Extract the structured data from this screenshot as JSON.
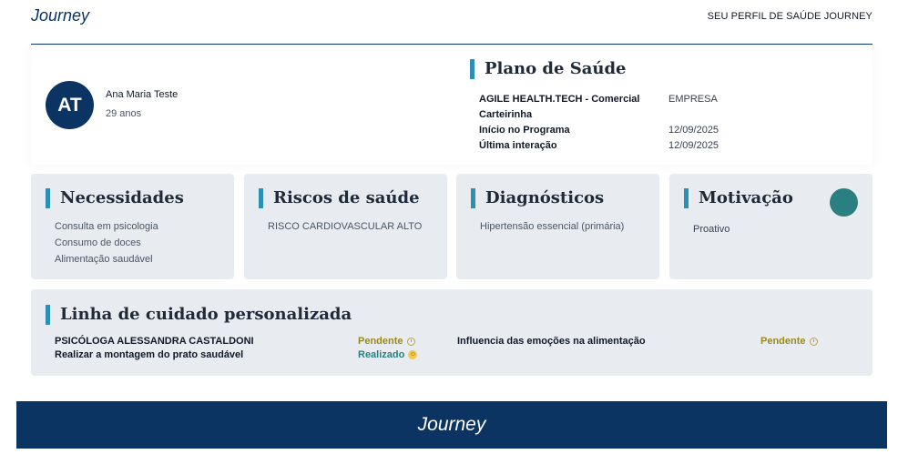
{
  "header": {
    "brand": "Journey",
    "subtitle": "SEU PERFIL DE SAÚDE JOURNEY"
  },
  "profile": {
    "initials": "AT",
    "name": "Ana Maria Teste",
    "age": "29 anos"
  },
  "plan": {
    "title": "Plano de Saúde",
    "rows": [
      {
        "label": "AGILE HEALTH.TECH - Comercial",
        "value": "EMPRESA"
      },
      {
        "label": "Carteirinha",
        "value": ""
      },
      {
        "label": "Início no Programa",
        "value": "12/09/2025"
      },
      {
        "label": "Última interação",
        "value": "12/09/2025"
      }
    ]
  },
  "needs": {
    "title": "Necessidades",
    "items": [
      "Consulta em psicologia",
      "Consumo de doces",
      "Alimentação saudável"
    ]
  },
  "risks": {
    "title": "Riscos de saúde",
    "items": [
      "RISCO CARDIOVASCULAR ALTO"
    ]
  },
  "diagnostics": {
    "title": "Diagnósticos",
    "items": [
      "Hipertensão essencial (primária)"
    ]
  },
  "motivation": {
    "title": "Motivação",
    "value": "Proativo",
    "indicator_color": "#2a8080"
  },
  "care_line": {
    "title": "Linha de cuidado personalizada",
    "items": [
      {
        "label": "PSICÓLOGA ALESSANDRA CASTALDONI",
        "status": "Pendente",
        "icon": "clock-icon"
      },
      {
        "label": "Realizar a montagem do prato saudável",
        "status": "Realizado",
        "icon": "smile-icon"
      },
      {
        "label": "Influencia das emoções na alimentação",
        "status": "Pendente",
        "icon": "clock-icon"
      }
    ]
  },
  "footer": {
    "brand": "Journey"
  },
  "colors": {
    "primary": "#0b3463",
    "accent": "#2c8fb5",
    "card_bg": "#e8ecf0",
    "pending": "#9a8a1a",
    "done": "#2a8080"
  }
}
